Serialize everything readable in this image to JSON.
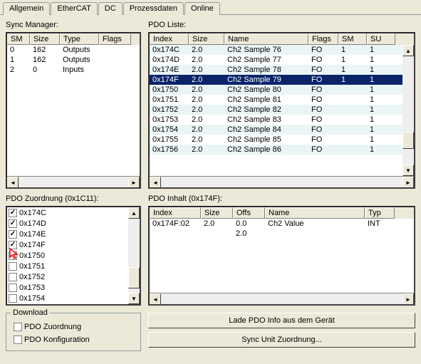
{
  "tabs": {
    "items": [
      "Allgemein",
      "EtherCAT",
      "DC",
      "Prozessdaten",
      "Online"
    ],
    "active": 3
  },
  "sync_manager": {
    "label": "Sync Manager:",
    "cols": [
      "SM",
      "Size",
      "Type",
      "Flags"
    ],
    "rows": [
      {
        "sm": "0",
        "size": "162",
        "type": "Outputs",
        "flags": ""
      },
      {
        "sm": "1",
        "size": "162",
        "type": "Outputs",
        "flags": ""
      },
      {
        "sm": "2",
        "size": "0",
        "type": "Inputs",
        "flags": ""
      }
    ]
  },
  "pdo_liste": {
    "label": "PDO Liste:",
    "cols": [
      "Index",
      "Size",
      "Name",
      "Flags",
      "SM",
      "SU"
    ],
    "rows": [
      {
        "idx": "0x174C",
        "size": "2.0",
        "name": "Ch2 Sample 76",
        "flags": "FO",
        "sm": "1",
        "su": "1",
        "sel": false
      },
      {
        "idx": "0x174D",
        "size": "2.0",
        "name": "Ch2 Sample 77",
        "flags": "FO",
        "sm": "1",
        "su": "1",
        "sel": false
      },
      {
        "idx": "0x174E",
        "size": "2.0",
        "name": "Ch2 Sample 78",
        "flags": "FO",
        "sm": "1",
        "su": "1",
        "sel": false
      },
      {
        "idx": "0x174F",
        "size": "2.0",
        "name": "Ch2 Sample 79",
        "flags": "FO",
        "sm": "1",
        "su": "1",
        "sel": true
      },
      {
        "idx": "0x1750",
        "size": "2.0",
        "name": "Ch2 Sample 80",
        "flags": "FO",
        "sm": "",
        "su": "1",
        "sel": false
      },
      {
        "idx": "0x1751",
        "size": "2.0",
        "name": "Ch2 Sample 81",
        "flags": "FO",
        "sm": "",
        "su": "1",
        "sel": false
      },
      {
        "idx": "0x1752",
        "size": "2.0",
        "name": "Ch2 Sample 82",
        "flags": "FO",
        "sm": "",
        "su": "1",
        "sel": false
      },
      {
        "idx": "0x1753",
        "size": "2.0",
        "name": "Ch2 Sample 83",
        "flags": "FO",
        "sm": "",
        "su": "1",
        "sel": false
      },
      {
        "idx": "0x1754",
        "size": "2.0",
        "name": "Ch2 Sample 84",
        "flags": "FO",
        "sm": "",
        "su": "1",
        "sel": false
      },
      {
        "idx": "0x1755",
        "size": "2.0",
        "name": "Ch2 Sample 85",
        "flags": "FO",
        "sm": "",
        "su": "1",
        "sel": false
      },
      {
        "idx": "0x1756",
        "size": "2.0",
        "name": "Ch2 Sample 86",
        "flags": "FO",
        "sm": "",
        "su": "1",
        "sel": false
      }
    ]
  },
  "pdo_zuordnung": {
    "label": "PDO Zuordnung (0x1C11):",
    "items": [
      {
        "id": "0x174C",
        "checked": true
      },
      {
        "id": "0x174D",
        "checked": true
      },
      {
        "id": "0x174E",
        "checked": true
      },
      {
        "id": "0x174F",
        "checked": true
      },
      {
        "id": "0x1750",
        "checked": false
      },
      {
        "id": "0x1751",
        "checked": false
      },
      {
        "id": "0x1752",
        "checked": false
      },
      {
        "id": "0x1753",
        "checked": false
      },
      {
        "id": "0x1754",
        "checked": false
      }
    ],
    "cursor_on_index": 4
  },
  "pdo_inhalt": {
    "label": "PDO Inhalt (0x174F):",
    "cols": [
      "Index",
      "Size",
      "Offs",
      "Name",
      "Typ"
    ],
    "rows": [
      {
        "idx": "0x174F:02",
        "size": "2.0",
        "offs": "0.0",
        "name": "Ch2 Value",
        "type": "INT"
      },
      {
        "idx": "",
        "size": "",
        "offs": "2.0",
        "name": "",
        "type": ""
      }
    ]
  },
  "download": {
    "legend": "Download",
    "opt1": {
      "label": "PDO Zuordnung",
      "checked": false
    },
    "opt2": {
      "label": "PDO Konfiguration",
      "checked": false
    }
  },
  "buttons": {
    "load": "Lade PDO Info aus dem Gerät",
    "sync": "Sync Unit Zuordnung..."
  }
}
